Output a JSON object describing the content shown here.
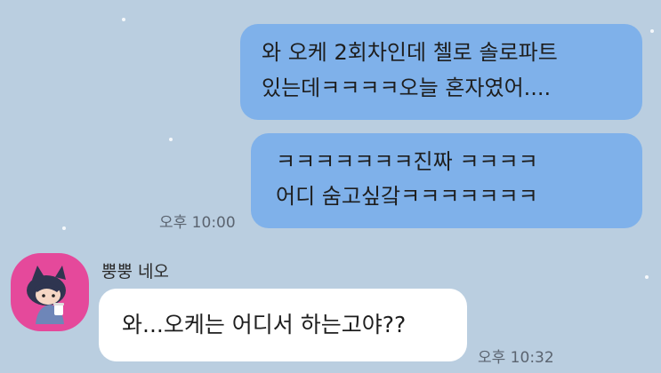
{
  "messages": [
    {
      "direction": "outgoing",
      "lines": [
        "와 오케 2회차인데 첼로 솔로파트",
        "있는데ㅋㅋㅋㅋ오늘 혼자였어...."
      ],
      "time": ""
    },
    {
      "direction": "outgoing",
      "lines": [
        "ㅋㅋㅋㅋㅋㅋㅋ진짜 ㅋㅋㅋㅋ",
        "어디 숨고싶갘ㅋㅋㅋㅋㅋㅋㅋ"
      ],
      "time": "오후 10:00"
    },
    {
      "direction": "incoming",
      "sender": "뿡뿡 네오",
      "avatar_icon": "neo-character-icon",
      "lines": [
        "와...오케는 어디서 하는고야??"
      ],
      "time": "오후 10:32"
    }
  ],
  "colors": {
    "background": "#bacee0",
    "outgoing_bubble": "#7fb1ea",
    "incoming_bubble": "#ffffff",
    "avatar_background": "#e5499b"
  }
}
